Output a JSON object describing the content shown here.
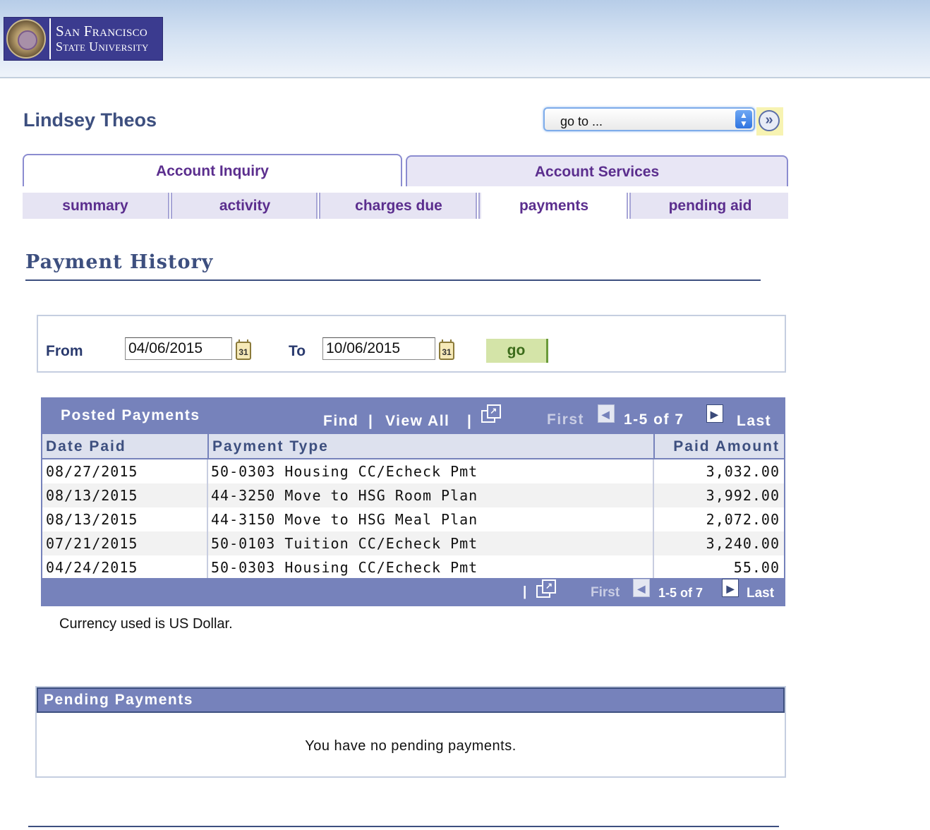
{
  "header": {
    "logo_line1": "San Francisco",
    "logo_line2": "State University"
  },
  "student": {
    "name": "Lindsey Theos"
  },
  "goto": {
    "selected": "go to ..."
  },
  "tabs": [
    {
      "label": "Account Inquiry",
      "active": true
    },
    {
      "label": "Account Services",
      "active": false
    }
  ],
  "subtabs": [
    {
      "label": "summary"
    },
    {
      "label": "activity"
    },
    {
      "label": "charges due"
    },
    {
      "label": "payments",
      "active": true
    },
    {
      "label": "pending aid"
    }
  ],
  "page_title": "Payment History",
  "date_filter": {
    "from_label": "From",
    "from_value": "04/06/2015",
    "to_label": "To",
    "to_value": "10/06/2015",
    "go_label": "go",
    "calendar_icon_text": "31"
  },
  "posted_payments": {
    "title": "Posted Payments",
    "find": "Find",
    "view_all": "View All",
    "sep": "|",
    "first": "First",
    "last": "Last",
    "range": "1-5 of 7",
    "columns": [
      "Date Paid",
      "Payment Type",
      "Paid Amount"
    ],
    "rows": [
      {
        "date": "08/27/2015",
        "type": "50-0303 Housing CC/Echeck Pmt",
        "amount": "3,032.00"
      },
      {
        "date": "08/13/2015",
        "type": "44-3250 Move to HSG Room Plan",
        "amount": "3,992.00"
      },
      {
        "date": "08/13/2015",
        "type": "44-3150 Move to HSG Meal Plan",
        "amount": "2,072.00"
      },
      {
        "date": "07/21/2015",
        "type": "50-0103 Tuition CC/Echeck Pmt",
        "amount": "3,240.00"
      },
      {
        "date": "04/24/2015",
        "type": "50-0303 Housing CC/Echeck Pmt",
        "amount": "55.00"
      }
    ]
  },
  "currency_note": "Currency used is US Dollar.",
  "pending_payments": {
    "title": "Pending Payments",
    "message": "You have no pending payments."
  }
}
